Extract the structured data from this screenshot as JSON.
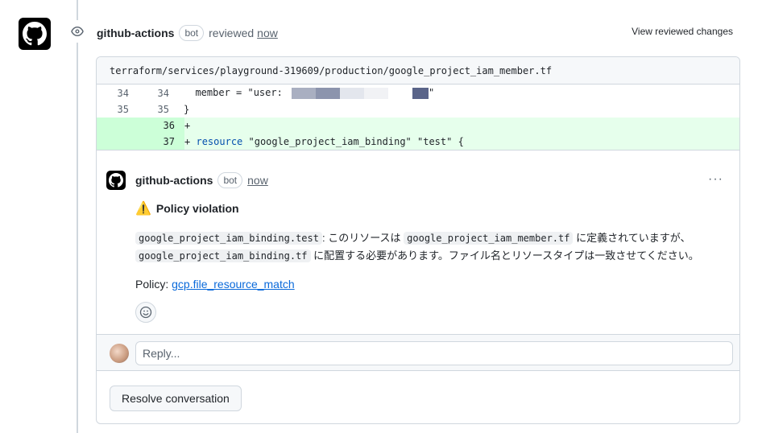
{
  "review": {
    "author": "github-actions",
    "bot_label": "bot",
    "action": "reviewed",
    "time": "now",
    "view_changes_label": "View reviewed changes"
  },
  "file": {
    "path": "terraform/services/playground-319609/production/google_project_iam_member.tf"
  },
  "diff": {
    "lines": [
      {
        "old": "34",
        "new": "34",
        "code_prefix": "  member = \"user: ",
        "code_suffix": "\""
      },
      {
        "old": "35",
        "new": "35",
        "code": "}"
      },
      {
        "old": "",
        "new": "36",
        "sign": "+",
        "code": ""
      },
      {
        "old": "",
        "new": "37",
        "sign": "+",
        "kw": "resource",
        "code": " \"google_project_iam_binding\" \"test\" {"
      }
    ]
  },
  "comment": {
    "author": "github-actions",
    "bot_label": "bot",
    "time": "now",
    "menu": "···",
    "warning_icon": "⚠️",
    "title": "Policy violation",
    "code1": "google_project_iam_binding.test",
    "text1": ": このリソースは",
    "code2": "google_project_iam_member.tf",
    "text2": "に定義されていますが、",
    "code3": "google_project_iam_binding.tf",
    "text3": "に配置する必要があります。ファイル名とリソースタイプは一致させてください。",
    "policy_label": "Policy:",
    "policy_link": "gcp.file_resource_match"
  },
  "reply": {
    "placeholder": "Reply..."
  },
  "resolve_label": "Resolve conversation",
  "colors": {
    "added_bg": "#e6ffec",
    "added_ln_bg": "#ccffd8",
    "link": "#0969da",
    "keyword": "#0550ae"
  }
}
